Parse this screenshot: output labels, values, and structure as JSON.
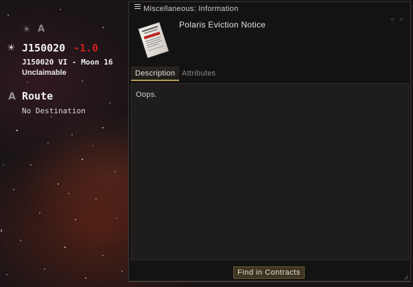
{
  "overlay": {
    "top_security_letter": "A",
    "system_name": "J150020",
    "security_status": "-1.0",
    "location": "J150020 VI - Moon 16",
    "claim_status": "Unclaimable",
    "route_letter": "A",
    "route_title": "Route",
    "route_destination": "No Destination"
  },
  "window": {
    "title": "Miscellaneous: Information",
    "item_name": "Polaris Eviction Notice",
    "tabs": [
      {
        "label": "Description",
        "active": true
      },
      {
        "label": "Attributes",
        "active": false
      }
    ],
    "description": "Oops.",
    "find_button": "Find in Contracts",
    "icons": [
      "menu-icon",
      "collapse-icon",
      "eviction-notice-icon",
      "resize-grip-icon"
    ]
  },
  "colors": {
    "security_status": "#d22020",
    "tab_accent": "#b79a5c",
    "button_bg": "#3f3523"
  }
}
